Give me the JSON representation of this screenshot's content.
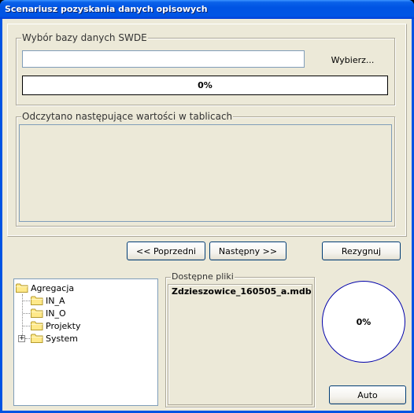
{
  "window": {
    "title": "Scenariusz pozyskania danych opisowych"
  },
  "swde_group": {
    "label": "Wybór bazy danych SWDE",
    "path_value": "",
    "browse_label": "Wybierz...",
    "progress_text": "0%",
    "progress_value": 0
  },
  "values_group": {
    "label": "Odczytano następujące wartości w tablicach"
  },
  "nav": {
    "prev_label": "<< Poprzedni",
    "next_label": "Następny >>",
    "cancel_label": "Rezygnuj"
  },
  "tree": {
    "root": "Agregacja",
    "children": [
      "IN_A",
      "IN_O",
      "Projekty",
      "System"
    ],
    "expand_symbol": "+"
  },
  "files_group": {
    "label": "Dostępne pliki",
    "items": [
      "Zdzieszowice_160505_a.mdb"
    ]
  },
  "circle_progress": {
    "text": "0%",
    "value": 0
  },
  "auto_label": "Auto"
}
